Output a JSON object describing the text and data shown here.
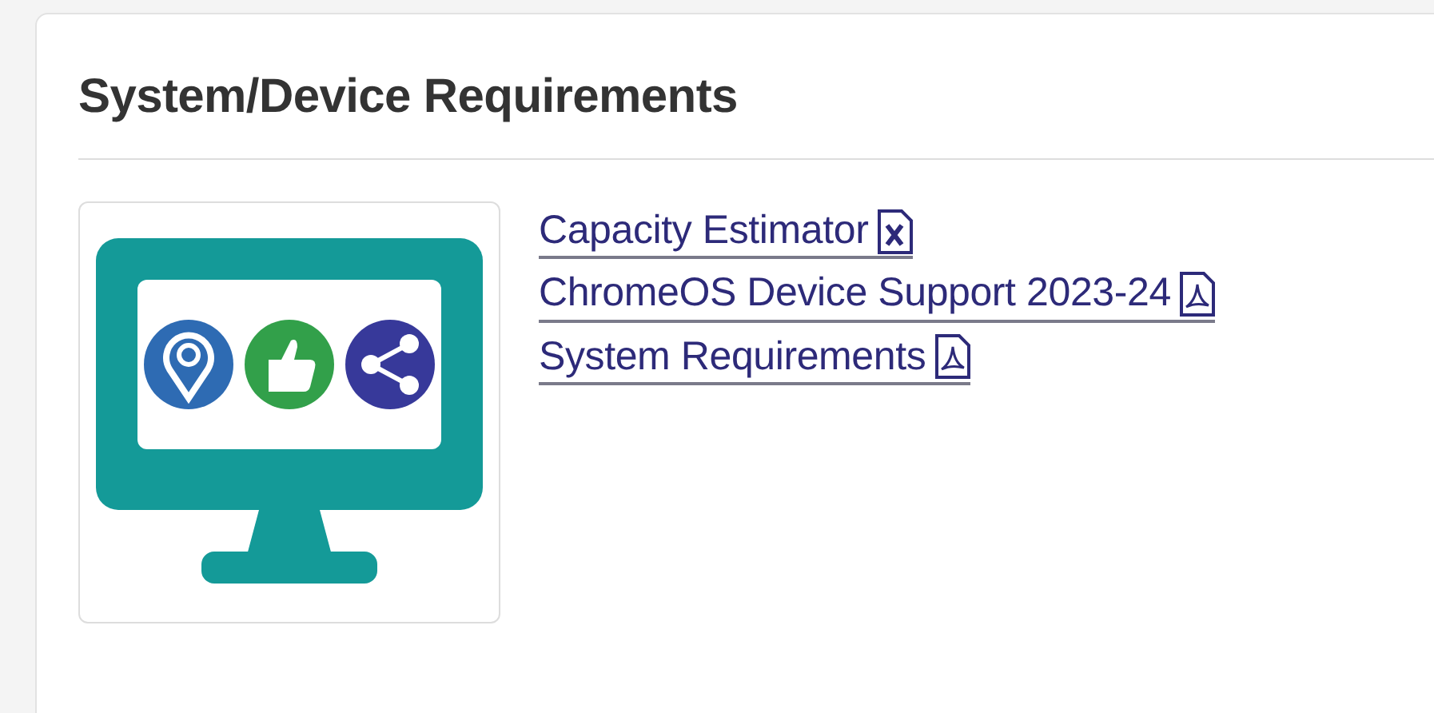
{
  "section": {
    "title": "System/Device Requirements"
  },
  "links": [
    {
      "label": "Capacity Estimator",
      "kind": "spreadsheet"
    },
    {
      "label": "ChromeOS Device Support 2023-24",
      "kind": "pdf"
    },
    {
      "label": "System Requirements",
      "kind": "pdf"
    }
  ]
}
